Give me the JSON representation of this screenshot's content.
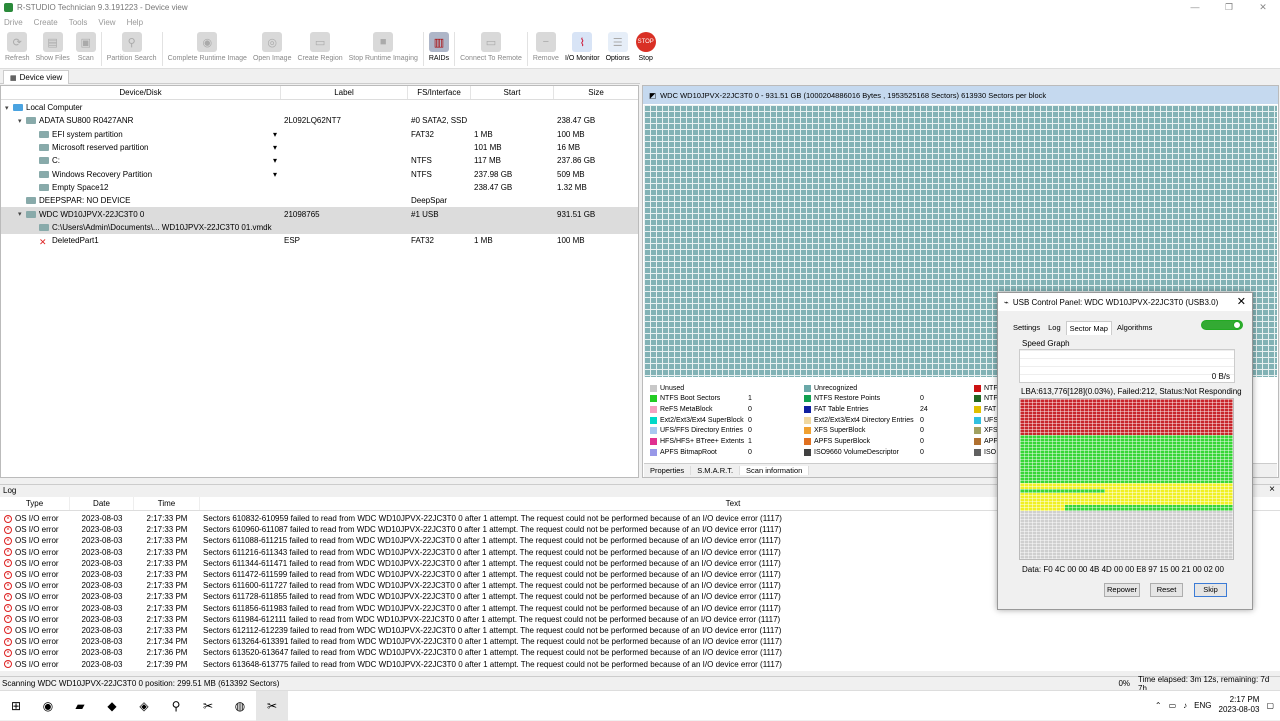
{
  "window": {
    "title": "R-STUDIO Technician 9.3.191223 - Device view",
    "min": "—",
    "max": "❐",
    "close": "✕"
  },
  "menu": [
    "Drive",
    "Create",
    "Tools",
    "View",
    "Help"
  ],
  "toolbar": [
    {
      "label": "Refresh",
      "icon": "refresh-icon",
      "glyph": "⟳",
      "enabled": false
    },
    {
      "label": "Show Files",
      "icon": "files-icon",
      "glyph": "▤",
      "enabled": false
    },
    {
      "label": "Scan",
      "icon": "scan-icon",
      "glyph": "▣",
      "enabled": false
    },
    {
      "label": "Partition Search",
      "icon": "partition-search-icon",
      "glyph": "⚲",
      "enabled": false
    },
    {
      "label": "Complete Runtime Image",
      "icon": "runtime-image-icon",
      "glyph": "◉",
      "enabled": false
    },
    {
      "label": "Open Image",
      "icon": "open-image-icon",
      "glyph": "◎",
      "enabled": false
    },
    {
      "label": "Create Region",
      "icon": "create-region-icon",
      "glyph": "▭",
      "enabled": false
    },
    {
      "label": "Stop Runtime Imaging",
      "icon": "stop-imaging-icon",
      "glyph": "■",
      "enabled": false
    },
    {
      "label": "RAIDs",
      "icon": "raid-icon",
      "glyph": "▥",
      "enabled": true
    },
    {
      "label": "Connect To Remote",
      "icon": "remote-icon",
      "glyph": "▭",
      "enabled": false
    },
    {
      "label": "Remove",
      "icon": "remove-icon",
      "glyph": "−",
      "enabled": false
    },
    {
      "label": "I/O Monitor",
      "icon": "io-monitor-icon",
      "glyph": "⌇",
      "enabled": true
    },
    {
      "label": "Options",
      "icon": "options-icon",
      "glyph": "☰",
      "enabled": true
    },
    {
      "label": "Stop",
      "icon": "stop-icon",
      "glyph": "STOP",
      "enabled": true
    }
  ],
  "tab_device_view": "Device view",
  "tree_columns": [
    "Device/Disk",
    "Label",
    "FS/Interface",
    "Start",
    "Size"
  ],
  "tree_rows": [
    {
      "indent": 0,
      "exp": "▾",
      "name": "Local Computer",
      "label": "",
      "fs": "",
      "start": "",
      "size": "",
      "dd": false,
      "sel": false
    },
    {
      "indent": 1,
      "exp": "▾",
      "name": "ADATA SU800 R0427ANR",
      "label": "2L092LQ62NT7",
      "fs": "#0 SATA2, SSD",
      "start": "",
      "size": "238.47 GB",
      "dd": false,
      "sel": false
    },
    {
      "indent": 2,
      "exp": "",
      "name": "EFI system partition",
      "label": "",
      "fs": "FAT32",
      "start": "1 MB",
      "size": "100 MB",
      "dd": true,
      "sel": false
    },
    {
      "indent": 2,
      "exp": "",
      "name": "Microsoft reserved partition",
      "label": "",
      "fs": "",
      "start": "101 MB",
      "size": "16 MB",
      "dd": true,
      "sel": false
    },
    {
      "indent": 2,
      "exp": "",
      "name": "C:",
      "label": "",
      "fs": "NTFS",
      "start": "117 MB",
      "size": "237.86 GB",
      "dd": true,
      "sel": false
    },
    {
      "indent": 2,
      "exp": "",
      "name": "Windows Recovery Partition",
      "label": "",
      "fs": "NTFS",
      "start": "237.98 GB",
      "size": "509 MB",
      "dd": true,
      "sel": false
    },
    {
      "indent": 2,
      "exp": "",
      "name": "Empty Space12",
      "label": "",
      "fs": "",
      "start": "238.47 GB",
      "size": "1.32 MB",
      "dd": false,
      "sel": false
    },
    {
      "indent": 1,
      "exp": "",
      "name": "DEEPSPAR: NO DEVICE",
      "label": "",
      "fs": "DeepSpar",
      "start": "",
      "size": "",
      "dd": false,
      "sel": false
    },
    {
      "indent": 1,
      "exp": "▾",
      "name": "WDC WD10JPVX-22JC3T0 0",
      "label": "21098765",
      "fs": "#1 USB",
      "start": "",
      "size": "931.51 GB",
      "dd": false,
      "sel": true
    },
    {
      "indent": 2,
      "exp": "",
      "name": "C:\\Users\\Admin\\Documents\\... WD10JPVX-22JC3T0 01.vmdk",
      "label": "",
      "fs": "",
      "start": "",
      "size": "",
      "dd": false,
      "sel": true
    },
    {
      "indent": 2,
      "exp": "",
      "name": "DeletedPart1",
      "label": "ESP",
      "fs": "FAT32",
      "start": "1 MB",
      "size": "100 MB",
      "dd": false,
      "sel": false
    }
  ],
  "right_header": "WDC WD10JPVX-22JC3T0 0 - 931.51 GB (1000204886016 Bytes , 1953525168 Sectors) 613930 Sectors per block",
  "legend": [
    {
      "label": "Unused",
      "value": "",
      "color": "#c8c8c8"
    },
    {
      "label": "NTFS Boot Sectors",
      "value": "1",
      "color": "#22cc22"
    },
    {
      "label": "ReFS MetaBlock",
      "value": "0",
      "color": "#f4a0c0"
    },
    {
      "label": "Ext2/Ext3/Ext4 SuperBlock",
      "value": "0",
      "color": "#00d8c8"
    },
    {
      "label": "UFS/FFS Directory Entries",
      "value": "0",
      "color": "#a8c8f0"
    },
    {
      "label": "HFS/HFS+ BTree+ Extents",
      "value": "1",
      "color": "#e03090"
    },
    {
      "label": "APFS BitmapRoot",
      "value": "0",
      "color": "#9898e8"
    },
    {
      "label": "Unrecognized",
      "value": "",
      "color": "#6aa8a8"
    },
    {
      "label": "NTFS Restore Points",
      "value": "0",
      "color": "#10a050"
    },
    {
      "label": "FAT Table Entries",
      "value": "24",
      "color": "#1020a0"
    },
    {
      "label": "Ext2/Ext3/Ext4 Directory Entries",
      "value": "0",
      "color": "#f0d8a0"
    },
    {
      "label": "XFS SuperBlock",
      "value": "0",
      "color": "#f0a030"
    },
    {
      "label": "APFS SuperBlock",
      "value": "0",
      "color": "#e07020"
    },
    {
      "label": "ISO9660 VolumeDescriptor",
      "value": "0",
      "color": "#404040"
    },
    {
      "label": "NTF",
      "value": "",
      "color": "#cc1111"
    },
    {
      "label": "NTF",
      "value": "",
      "color": "#226622"
    },
    {
      "label": "FAT",
      "value": "",
      "color": "#e0c000"
    },
    {
      "label": "UFS",
      "value": "",
      "color": "#30c0e0"
    },
    {
      "label": "XFS",
      "value": "",
      "color": "#a0a060"
    },
    {
      "label": "APF",
      "value": "",
      "color": "#b07030"
    },
    {
      "label": "ISO",
      "value": "",
      "color": "#606060"
    }
  ],
  "right_tabs": [
    "Properties",
    "S.M.A.R.T.",
    "Scan information"
  ],
  "log": {
    "title": "Log",
    "columns": [
      "Type",
      "Date",
      "Time",
      "Text"
    ],
    "rows": [
      {
        "type": "OS I/O error",
        "date": "2023-08-03",
        "time": "2:17:33 PM",
        "text": "Sectors 610832-610959 failed to read from WDC WD10JPVX-22JC3T0 0 after 1 attempt. The request could not be performed because of an I/O device error (1117)"
      },
      {
        "type": "OS I/O error",
        "date": "2023-08-03",
        "time": "2:17:33 PM",
        "text": "Sectors 610960-611087 failed to read from WDC WD10JPVX-22JC3T0 0 after 1 attempt. The request could not be performed because of an I/O device error (1117)"
      },
      {
        "type": "OS I/O error",
        "date": "2023-08-03",
        "time": "2:17:33 PM",
        "text": "Sectors 611088-611215 failed to read from WDC WD10JPVX-22JC3T0 0 after 1 attempt. The request could not be performed because of an I/O device error (1117)"
      },
      {
        "type": "OS I/O error",
        "date": "2023-08-03",
        "time": "2:17:33 PM",
        "text": "Sectors 611216-611343 failed to read from WDC WD10JPVX-22JC3T0 0 after 1 attempt. The request could not be performed because of an I/O device error (1117)"
      },
      {
        "type": "OS I/O error",
        "date": "2023-08-03",
        "time": "2:17:33 PM",
        "text": "Sectors 611344-611471 failed to read from WDC WD10JPVX-22JC3T0 0 after 1 attempt. The request could not be performed because of an I/O device error (1117)"
      },
      {
        "type": "OS I/O error",
        "date": "2023-08-03",
        "time": "2:17:33 PM",
        "text": "Sectors 611472-611599 failed to read from WDC WD10JPVX-22JC3T0 0 after 1 attempt. The request could not be performed because of an I/O device error (1117)"
      },
      {
        "type": "OS I/O error",
        "date": "2023-08-03",
        "time": "2:17:33 PM",
        "text": "Sectors 611600-611727 failed to read from WDC WD10JPVX-22JC3T0 0 after 1 attempt. The request could not be performed because of an I/O device error (1117)"
      },
      {
        "type": "OS I/O error",
        "date": "2023-08-03",
        "time": "2:17:33 PM",
        "text": "Sectors 611728-611855 failed to read from WDC WD10JPVX-22JC3T0 0 after 1 attempt. The request could not be performed because of an I/O device error (1117)"
      },
      {
        "type": "OS I/O error",
        "date": "2023-08-03",
        "time": "2:17:33 PM",
        "text": "Sectors 611856-611983 failed to read from WDC WD10JPVX-22JC3T0 0 after 1 attempt. The request could not be performed because of an I/O device error (1117)"
      },
      {
        "type": "OS I/O error",
        "date": "2023-08-03",
        "time": "2:17:33 PM",
        "text": "Sectors 611984-612111 failed to read from WDC WD10JPVX-22JC3T0 0 after 1 attempt. The request could not be performed because of an I/O device error (1117)"
      },
      {
        "type": "OS I/O error",
        "date": "2023-08-03",
        "time": "2:17:33 PM",
        "text": "Sectors 612112-612239 failed to read from WDC WD10JPVX-22JC3T0 0 after 1 attempt. The request could not be performed because of an I/O device error (1117)"
      },
      {
        "type": "OS I/O error",
        "date": "2023-08-03",
        "time": "2:17:34 PM",
        "text": "Sectors 613264-613391 failed to read from WDC WD10JPVX-22JC3T0 0 after 1 attempt. The request could not be performed because of an I/O device error (1117)"
      },
      {
        "type": "OS I/O error",
        "date": "2023-08-03",
        "time": "2:17:36 PM",
        "text": "Sectors 613520-613647 failed to read from WDC WD10JPVX-22JC3T0 0 after 1 attempt. The request could not be performed because of an I/O device error (1117)"
      },
      {
        "type": "OS I/O error",
        "date": "2023-08-03",
        "time": "2:17:39 PM",
        "text": "Sectors 613648-613775 failed to read from WDC WD10JPVX-22JC3T0 0 after 1 attempt. The request could not be performed because of an I/O device error (1117)"
      }
    ]
  },
  "status": {
    "left": "Scanning WDC WD10JPVX-22JC3T0 0 position: 299.51 MB (613392 Sectors)",
    "percent": "0%",
    "elapsed": "Time elapsed: 3m 12s, remaining: 7d 7h",
    "progress": 0
  },
  "usb_dialog": {
    "title": "USB Control Panel: WDC WD10JPVX-22JC3T0 (USB3.0)",
    "tabs": [
      "Settings",
      "Log",
      "Sector Map",
      "Algorithms"
    ],
    "active_tab": "Sector Map",
    "speed_graph_label": "Speed Graph",
    "speed_value": "0 B/s",
    "lba_info": "LBA:613,776[128](0.03%), Failed:212, Status:Not Responding",
    "data_info": "Data: F0 4C 00 00 4B 4D 00 00 E8 97 15 00 21 00 02 00",
    "buttons": [
      "Repower",
      "Reset",
      "Skip"
    ],
    "map_colors": {
      "bad": "#c8262c",
      "good": "#37d637",
      "slow": "#f0f024",
      "unread": "#cfcfcf"
    }
  },
  "taskbar": {
    "apps": [
      {
        "name": "start-icon",
        "glyph": "⊞"
      },
      {
        "name": "firefox-icon",
        "glyph": "◉"
      },
      {
        "name": "file-explorer-icon",
        "glyph": "▰"
      },
      {
        "name": "app-blue-icon",
        "glyph": "◆"
      },
      {
        "name": "app-green-icon",
        "glyph": "◈"
      },
      {
        "name": "magnifier-icon",
        "glyph": "⚲"
      },
      {
        "name": "rstudio-app-icon",
        "glyph": "✂"
      },
      {
        "name": "chrome-icon",
        "glyph": "◍"
      },
      {
        "name": "rstudio-active-icon",
        "glyph": "✂"
      }
    ],
    "lang": "ENG",
    "time": "2:17 PM",
    "date": "2023-08-03"
  }
}
